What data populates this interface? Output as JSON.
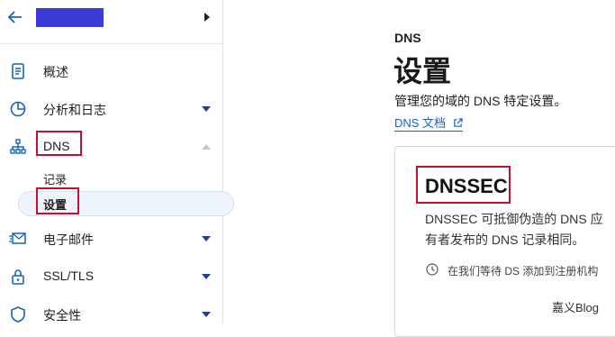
{
  "sidebar": {
    "items": [
      {
        "label": "概述"
      },
      {
        "label": "分析和日志"
      },
      {
        "label": "DNS"
      },
      {
        "label": "电子邮件"
      },
      {
        "label": "SSL/TLS"
      },
      {
        "label": "安全性"
      }
    ],
    "dns_sub": [
      {
        "label": "记录"
      },
      {
        "label": "设置"
      }
    ]
  },
  "main": {
    "breadcrumb": "DNS",
    "title": "设置",
    "description": "管理您的域的 DNS 特定设置。",
    "doc_link": "DNS 文档",
    "card": {
      "title": "DNSSEC",
      "line1": "DNSSEC 可抵御伪造的 DNS 应",
      "line2": "有者发布的 DNS 记录相同。",
      "pending": "在我们等待 DS 添加到注册机构"
    }
  },
  "watermark": "嘉义Blog",
  "colors": {
    "accent": "#1463c4",
    "highlight": "#c8102e",
    "account_block": "#3b3bd9"
  }
}
